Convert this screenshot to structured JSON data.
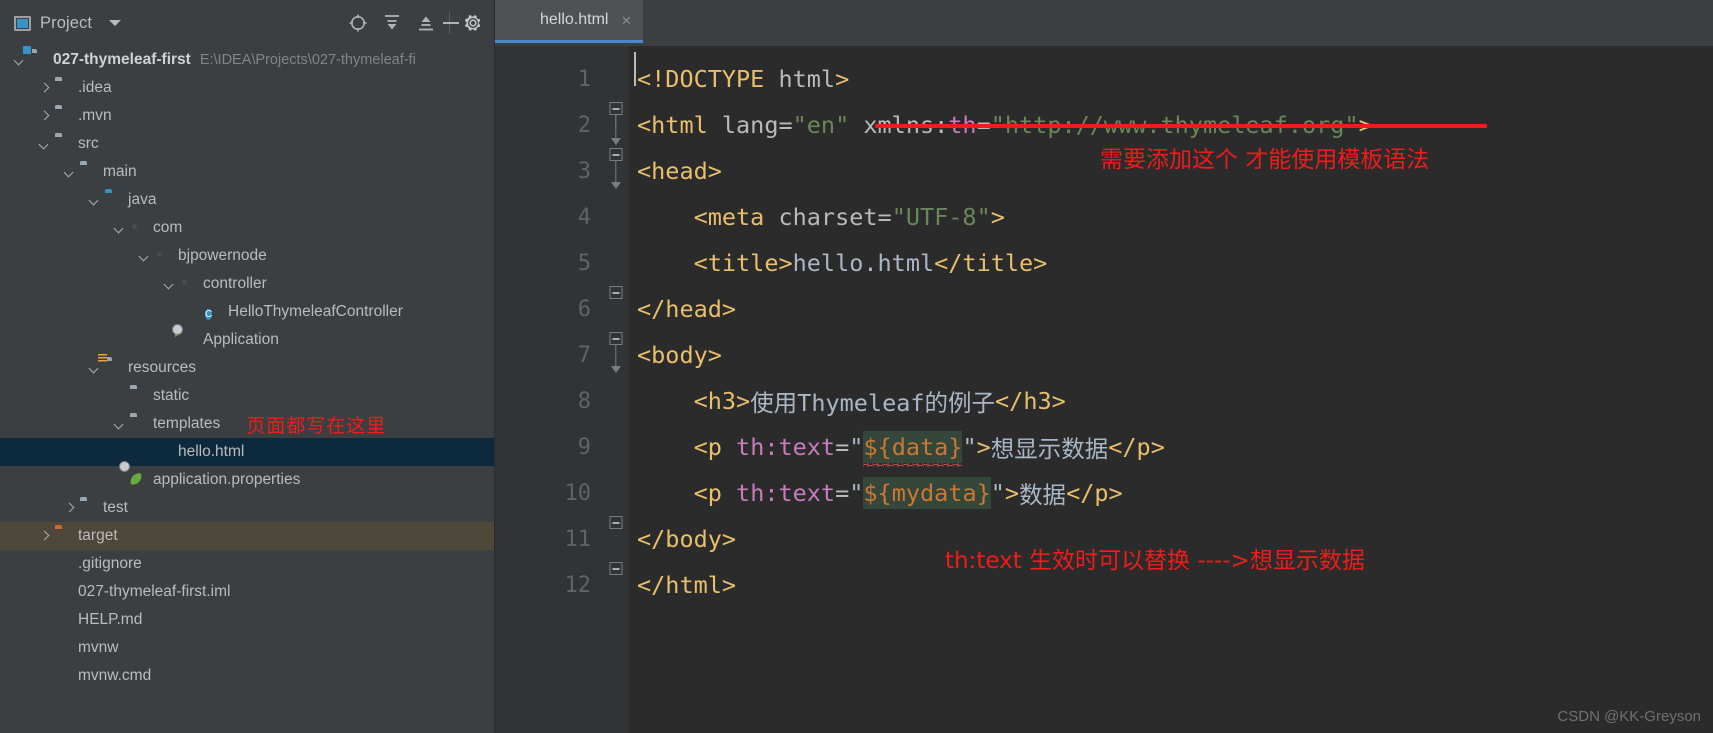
{
  "window": {
    "theme_bg": "#3c3f41",
    "editor_bg": "#2b2b2b",
    "accent": "#4a88c7",
    "annotation_color": "#f01b1b"
  },
  "project_panel": {
    "title": "Project",
    "icons": {
      "project_icon": "project-icon",
      "dropdown": "chevron-down-icon",
      "locate": "locate-target-icon",
      "expand_all": "expand-all-icon",
      "collapse_all": "collapse-all-icon",
      "settings": "gear-icon",
      "minimize": "minimize-icon"
    },
    "tree": [
      {
        "label": "027-thymeleaf-first",
        "path": "E:\\IDEA\\Projects\\027-thymeleaf-fi",
        "indent": 0,
        "arrow": "open",
        "icon": "module-folder",
        "bold": true,
        "name": "tree-item-project-root"
      },
      {
        "label": ".idea",
        "path": "",
        "indent": 1,
        "arrow": "closed",
        "icon": "folder",
        "bold": false,
        "name": "tree-item-idea"
      },
      {
        "label": ".mvn",
        "path": "",
        "indent": 1,
        "arrow": "closed",
        "icon": "folder",
        "bold": false,
        "name": "tree-item-mvn"
      },
      {
        "label": "src",
        "path": "",
        "indent": 1,
        "arrow": "open",
        "icon": "folder",
        "bold": false,
        "name": "tree-item-src"
      },
      {
        "label": "main",
        "path": "",
        "indent": 2,
        "arrow": "open",
        "icon": "folder",
        "bold": false,
        "name": "tree-item-main"
      },
      {
        "label": "java",
        "path": "",
        "indent": 3,
        "arrow": "open",
        "icon": "folder-blue",
        "bold": false,
        "name": "tree-item-java"
      },
      {
        "label": "com",
        "path": "",
        "indent": 4,
        "arrow": "open",
        "icon": "package",
        "bold": false,
        "name": "tree-item-com"
      },
      {
        "label": "bjpowernode",
        "path": "",
        "indent": 5,
        "arrow": "open",
        "icon": "package",
        "bold": false,
        "name": "tree-item-bjpowernode"
      },
      {
        "label": "controller",
        "path": "",
        "indent": 6,
        "arrow": "open",
        "icon": "package",
        "bold": false,
        "name": "tree-item-controller"
      },
      {
        "label": "HelloThymeleafController",
        "path": "",
        "indent": 7,
        "arrow": "none",
        "icon": "java-class",
        "bold": false,
        "name": "tree-item-hello-thymeleaf-controller"
      },
      {
        "label": "Application",
        "path": "",
        "indent": 6,
        "arrow": "none",
        "icon": "spring-boot",
        "bold": false,
        "name": "tree-item-application"
      },
      {
        "label": "resources",
        "path": "",
        "indent": 3,
        "arrow": "open",
        "icon": "folder-res",
        "bold": false,
        "name": "tree-item-resources"
      },
      {
        "label": "static",
        "path": "",
        "indent": 4,
        "arrow": "none",
        "icon": "folder",
        "bold": false,
        "name": "tree-item-static"
      },
      {
        "label": "templates",
        "path": "",
        "indent": 4,
        "arrow": "open",
        "icon": "folder",
        "bold": false,
        "name": "tree-item-templates",
        "note": "页面都写在这里"
      },
      {
        "label": "hello.html",
        "path": "",
        "indent": 5,
        "arrow": "none",
        "icon": "html-file",
        "bold": false,
        "name": "tree-item-hello-html",
        "selected": true
      },
      {
        "label": "application.properties",
        "path": "",
        "indent": 4,
        "arrow": "none",
        "icon": "properties",
        "bold": false,
        "name": "tree-item-application-properties"
      },
      {
        "label": "test",
        "path": "",
        "indent": 2,
        "arrow": "closed",
        "icon": "folder",
        "bold": false,
        "name": "tree-item-test"
      },
      {
        "label": "target",
        "path": "",
        "indent": 1,
        "arrow": "closed",
        "icon": "folder-orange",
        "bold": false,
        "name": "tree-item-target",
        "highlight": true
      },
      {
        "label": ".gitignore",
        "path": "",
        "indent": 1,
        "arrow": "none",
        "icon": "file-gitignore",
        "bold": false,
        "name": "tree-item-gitignore"
      },
      {
        "label": "027-thymeleaf-first.iml",
        "path": "",
        "indent": 1,
        "arrow": "none",
        "icon": "file-iml",
        "bold": false,
        "name": "tree-item-iml"
      },
      {
        "label": "HELP.md",
        "path": "",
        "indent": 1,
        "arrow": "none",
        "icon": "file-md",
        "bold": false,
        "name": "tree-item-help-md"
      },
      {
        "label": "mvnw",
        "path": "",
        "indent": 1,
        "arrow": "none",
        "icon": "file-sh",
        "bold": false,
        "name": "tree-item-mvnw"
      },
      {
        "label": "mvnw.cmd",
        "path": "",
        "indent": 1,
        "arrow": "none",
        "icon": "file-lines",
        "bold": false,
        "name": "tree-item-mvnw-cmd"
      }
    ],
    "tree_note": "页面都写在这里"
  },
  "editor": {
    "tab": {
      "label": "hello.html",
      "close": "×",
      "icon": "html-file-icon"
    },
    "line_numbers": [
      "1",
      "2",
      "3",
      "4",
      "5",
      "6",
      "7",
      "8",
      "9",
      "10",
      "11",
      "12"
    ],
    "lines": [
      {
        "n": "1",
        "tokens": [
          {
            "t": "<!DOCTYPE ",
            "c": "tag"
          },
          {
            "t": "html",
            "c": "attr"
          },
          {
            "t": ">",
            "c": "tag"
          }
        ]
      },
      {
        "n": "2",
        "tokens": [
          {
            "t": "<html ",
            "c": "tag"
          },
          {
            "t": "lang",
            "c": "attr"
          },
          {
            "t": "=",
            "c": "attr"
          },
          {
            "t": "\"en\"",
            "c": "val"
          },
          {
            "t": " xmlns:",
            "c": "attr"
          },
          {
            "t": "th",
            "c": "th"
          },
          {
            "t": "=",
            "c": "attr"
          },
          {
            "t": "\"http://www.thymeleaf.org\"",
            "c": "val"
          },
          {
            "t": ">",
            "c": "tag"
          }
        ]
      },
      {
        "n": "3",
        "tokens": [
          {
            "t": "<head>",
            "c": "tag"
          }
        ]
      },
      {
        "n": "4",
        "tokens": [
          {
            "t": "    <meta ",
            "c": "tag"
          },
          {
            "t": "charset",
            "c": "attr"
          },
          {
            "t": "=",
            "c": "attr"
          },
          {
            "t": "\"UTF-8\"",
            "c": "val"
          },
          {
            "t": ">",
            "c": "tag"
          }
        ]
      },
      {
        "n": "5",
        "tokens": [
          {
            "t": "    <title>",
            "c": "tag"
          },
          {
            "t": "hello.html",
            "c": "text"
          },
          {
            "t": "</title>",
            "c": "tag"
          }
        ]
      },
      {
        "n": "6",
        "tokens": [
          {
            "t": "</head>",
            "c": "tag"
          }
        ]
      },
      {
        "n": "7",
        "tokens": [
          {
            "t": "<body>",
            "c": "tag"
          }
        ]
      },
      {
        "n": "8",
        "tokens": [
          {
            "t": "    <h3>",
            "c": "tag"
          },
          {
            "t": "使用Thymeleaf的例子",
            "c": "text"
          },
          {
            "t": "</h3>",
            "c": "tag"
          }
        ]
      },
      {
        "n": "9",
        "tokens": [
          {
            "t": "    <p ",
            "c": "tag"
          },
          {
            "t": "th:text",
            "c": "th"
          },
          {
            "t": "=",
            "c": "attr"
          },
          {
            "t": "\"",
            "c": "text"
          },
          {
            "t": "${data}",
            "c": "expr-wavy"
          },
          {
            "t": "\"",
            "c": "text"
          },
          {
            "t": ">",
            "c": "tag"
          },
          {
            "t": "想显示数据",
            "c": "text"
          },
          {
            "t": "</p>",
            "c": "tag"
          }
        ]
      },
      {
        "n": "10",
        "tokens": [
          {
            "t": "    <p ",
            "c": "tag"
          },
          {
            "t": "th:text",
            "c": "th"
          },
          {
            "t": "=",
            "c": "attr"
          },
          {
            "t": "\"",
            "c": "text"
          },
          {
            "t": "${mydata}",
            "c": "expr"
          },
          {
            "t": "\"",
            "c": "text"
          },
          {
            "t": ">",
            "c": "tag"
          },
          {
            "t": "数据",
            "c": "text"
          },
          {
            "t": "</p>",
            "c": "tag"
          }
        ]
      },
      {
        "n": "11",
        "tokens": [
          {
            "t": "</body>",
            "c": "tag"
          }
        ]
      },
      {
        "n": "12",
        "tokens": [
          {
            "t": "</html>",
            "c": "tag"
          }
        ]
      }
    ],
    "annotations": [
      {
        "text": "需要添加这个 才能使用模板语法",
        "name": "annotation-xmlns-note"
      },
      {
        "text": "th:text 生效时可以替换 ---->想显示数据",
        "name": "annotation-thtext-note"
      }
    ]
  },
  "watermark": "CSDN @KK-Greyson"
}
